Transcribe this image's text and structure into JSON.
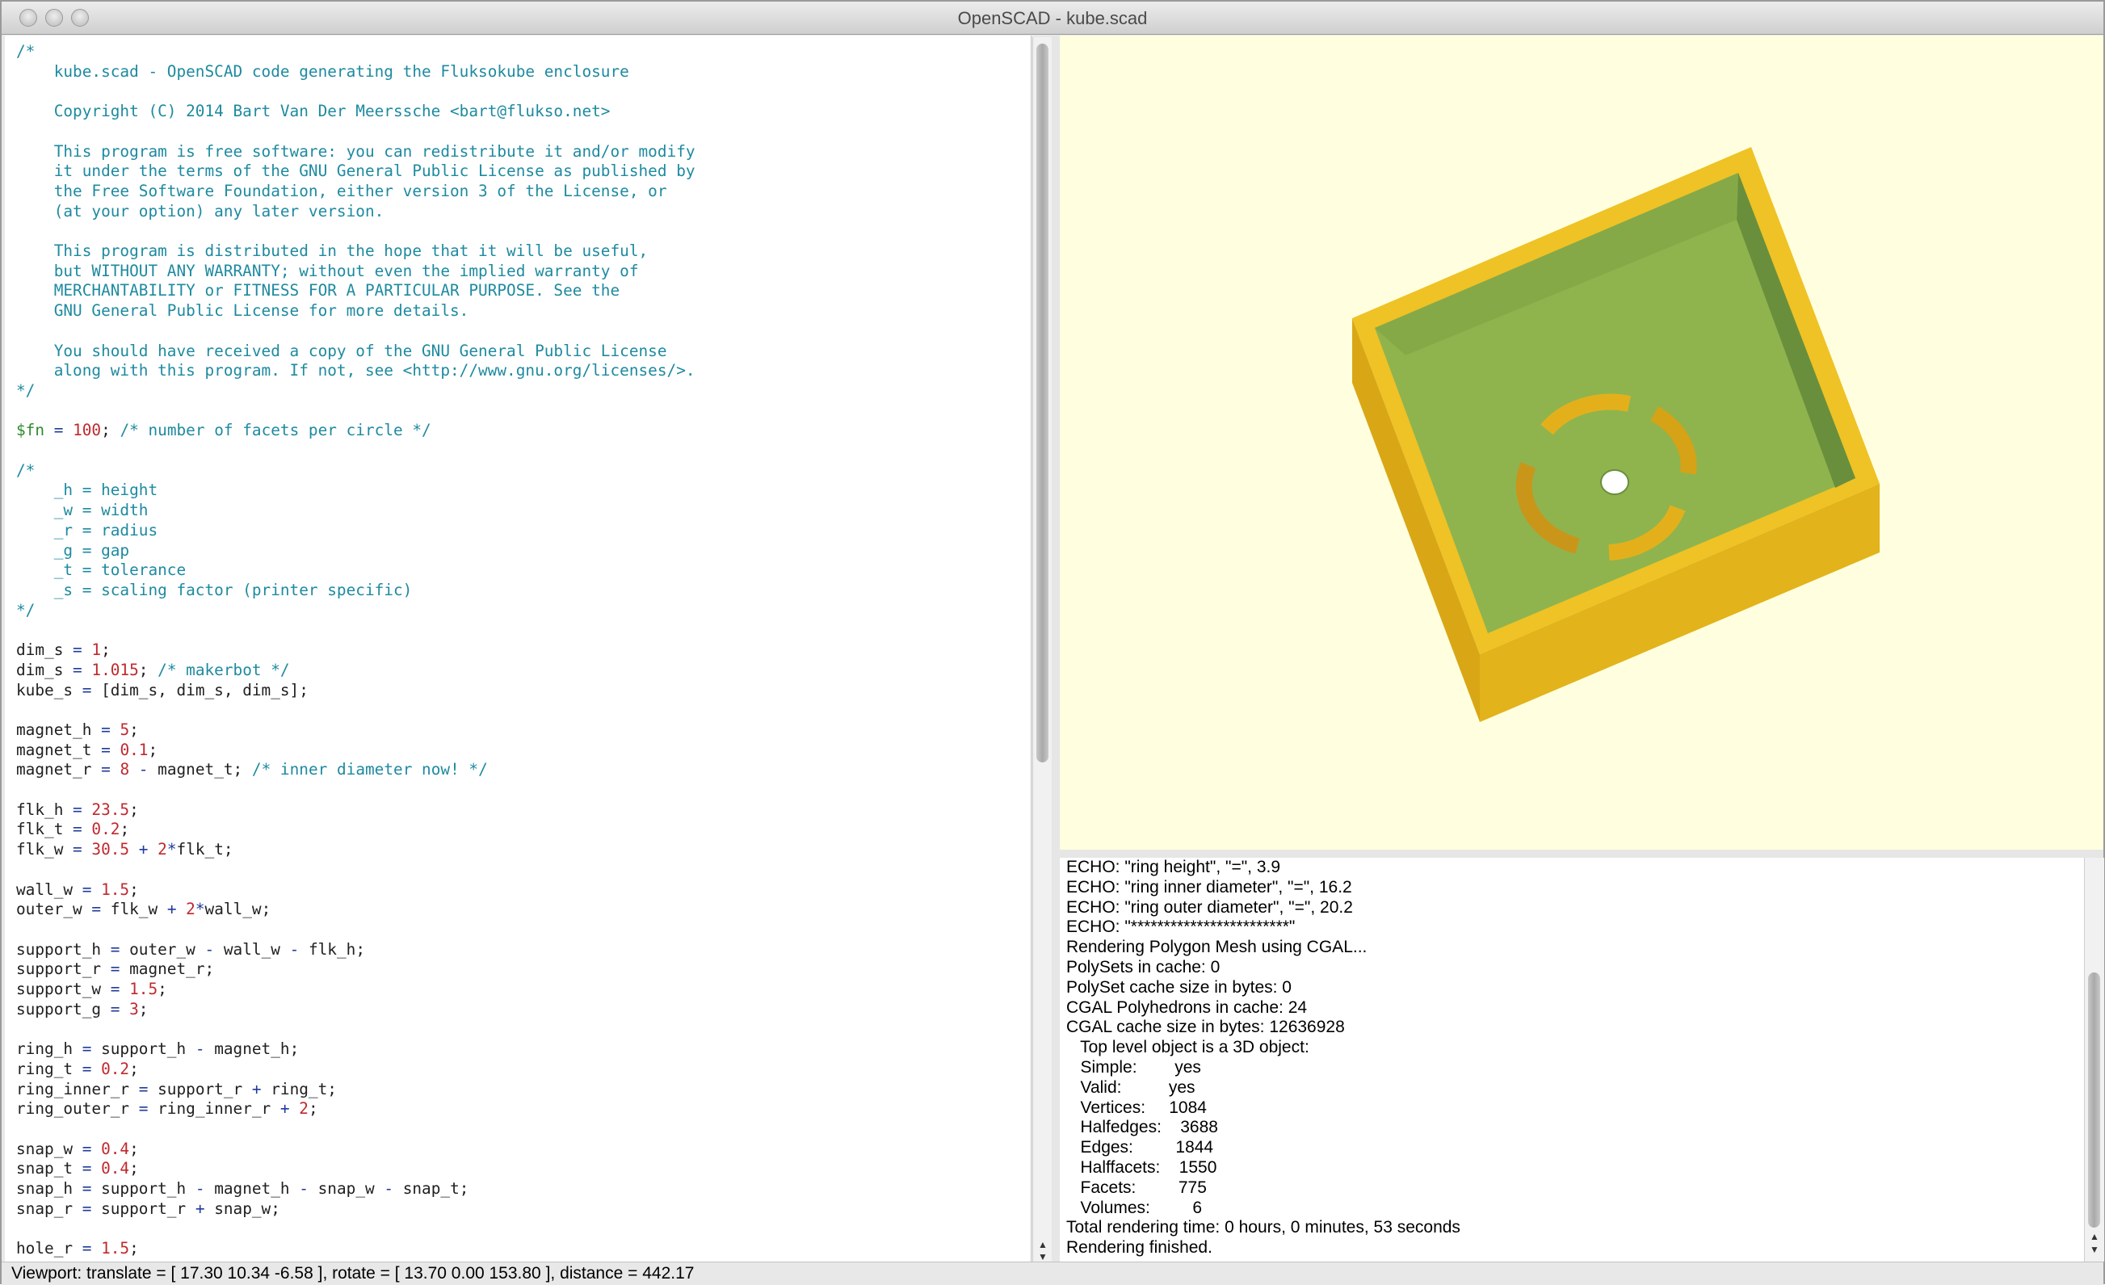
{
  "window": {
    "title": "OpenSCAD - kube.scad"
  },
  "editor": {
    "lines": [
      [
        {
          "c": "cm",
          "t": "/*"
        }
      ],
      [
        {
          "c": "cm",
          "t": "    kube.scad - OpenSCAD code generating the Fluksokube enclosure"
        }
      ],
      [],
      [
        {
          "c": "cm",
          "t": "    Copyright (C) 2014 Bart Van Der Meerssche <bart@flukso.net>"
        }
      ],
      [],
      [
        {
          "c": "cm",
          "t": "    This program is free software: you can redistribute it and/or modify"
        }
      ],
      [
        {
          "c": "cm",
          "t": "    it under the terms of the GNU General Public License as published by"
        }
      ],
      [
        {
          "c": "cm",
          "t": "    the Free Software Foundation, either version 3 of the License, or"
        }
      ],
      [
        {
          "c": "cm",
          "t": "    (at your option) any later version."
        }
      ],
      [],
      [
        {
          "c": "cm",
          "t": "    This program is distributed in the hope that it will be useful,"
        }
      ],
      [
        {
          "c": "cm",
          "t": "    but WITHOUT ANY WARRANTY; without even the implied warranty of"
        }
      ],
      [
        {
          "c": "cm",
          "t": "    MERCHANTABILITY or FITNESS FOR A PARTICULAR PURPOSE. See the"
        }
      ],
      [
        {
          "c": "cm",
          "t": "    GNU General Public License for more details."
        }
      ],
      [],
      [
        {
          "c": "cm",
          "t": "    You should have received a copy of the GNU General Public License"
        }
      ],
      [
        {
          "c": "cm",
          "t": "    along with this program. If not, see <http://www.gnu.org/licenses/>."
        }
      ],
      [
        {
          "c": "cm",
          "t": "*/"
        }
      ],
      [],
      [
        {
          "c": "sp",
          "t": "$fn"
        },
        {
          "c": "op",
          "t": " = "
        },
        {
          "c": "num",
          "t": "100"
        },
        {
          "c": "var",
          "t": "; "
        },
        {
          "c": "cm",
          "t": "/* number of facets per circle */"
        }
      ],
      [],
      [
        {
          "c": "cm",
          "t": "/*"
        }
      ],
      [
        {
          "c": "cm",
          "t": "    _h = height"
        }
      ],
      [
        {
          "c": "cm",
          "t": "    _w = width"
        }
      ],
      [
        {
          "c": "cm",
          "t": "    _r = radius"
        }
      ],
      [
        {
          "c": "cm",
          "t": "    _g = gap"
        }
      ],
      [
        {
          "c": "cm",
          "t": "    _t = tolerance"
        }
      ],
      [
        {
          "c": "cm",
          "t": "    _s = scaling factor (printer specific)"
        }
      ],
      [
        {
          "c": "cm",
          "t": "*/"
        }
      ],
      [],
      [
        {
          "c": "var",
          "t": "dim_s"
        },
        {
          "c": "op",
          "t": " = "
        },
        {
          "c": "num",
          "t": "1"
        },
        {
          "c": "var",
          "t": ";"
        }
      ],
      [
        {
          "c": "var",
          "t": "dim_s"
        },
        {
          "c": "op",
          "t": " = "
        },
        {
          "c": "num",
          "t": "1.015"
        },
        {
          "c": "var",
          "t": "; "
        },
        {
          "c": "cm",
          "t": "/* makerbot */"
        }
      ],
      [
        {
          "c": "var",
          "t": "kube_s"
        },
        {
          "c": "op",
          "t": " = "
        },
        {
          "c": "var",
          "t": "[dim_s, dim_s, dim_s];"
        }
      ],
      [],
      [
        {
          "c": "var",
          "t": "magnet_h"
        },
        {
          "c": "op",
          "t": " = "
        },
        {
          "c": "num",
          "t": "5"
        },
        {
          "c": "var",
          "t": ";"
        }
      ],
      [
        {
          "c": "var",
          "t": "magnet_t"
        },
        {
          "c": "op",
          "t": " = "
        },
        {
          "c": "num",
          "t": "0.1"
        },
        {
          "c": "var",
          "t": ";"
        }
      ],
      [
        {
          "c": "var",
          "t": "magnet_r"
        },
        {
          "c": "op",
          "t": " = "
        },
        {
          "c": "num",
          "t": "8"
        },
        {
          "c": "op",
          "t": " - "
        },
        {
          "c": "var",
          "t": "magnet_t; "
        },
        {
          "c": "cm",
          "t": "/* inner diameter now! */"
        }
      ],
      [],
      [
        {
          "c": "var",
          "t": "flk_h"
        },
        {
          "c": "op",
          "t": " = "
        },
        {
          "c": "num",
          "t": "23.5"
        },
        {
          "c": "var",
          "t": ";"
        }
      ],
      [
        {
          "c": "var",
          "t": "flk_t"
        },
        {
          "c": "op",
          "t": " = "
        },
        {
          "c": "num",
          "t": "0.2"
        },
        {
          "c": "var",
          "t": ";"
        }
      ],
      [
        {
          "c": "var",
          "t": "flk_w"
        },
        {
          "c": "op",
          "t": " = "
        },
        {
          "c": "num",
          "t": "30.5"
        },
        {
          "c": "op",
          "t": " + "
        },
        {
          "c": "num",
          "t": "2"
        },
        {
          "c": "op",
          "t": "*"
        },
        {
          "c": "var",
          "t": "flk_t;"
        }
      ],
      [],
      [
        {
          "c": "var",
          "t": "wall_w"
        },
        {
          "c": "op",
          "t": " = "
        },
        {
          "c": "num",
          "t": "1.5"
        },
        {
          "c": "var",
          "t": ";"
        }
      ],
      [
        {
          "c": "var",
          "t": "outer_w"
        },
        {
          "c": "op",
          "t": " = "
        },
        {
          "c": "var",
          "t": "flk_w"
        },
        {
          "c": "op",
          "t": " + "
        },
        {
          "c": "num",
          "t": "2"
        },
        {
          "c": "op",
          "t": "*"
        },
        {
          "c": "var",
          "t": "wall_w;"
        }
      ],
      [],
      [
        {
          "c": "var",
          "t": "support_h"
        },
        {
          "c": "op",
          "t": " = "
        },
        {
          "c": "var",
          "t": "outer_w"
        },
        {
          "c": "op",
          "t": " - "
        },
        {
          "c": "var",
          "t": "wall_w"
        },
        {
          "c": "op",
          "t": " - "
        },
        {
          "c": "var",
          "t": "flk_h;"
        }
      ],
      [
        {
          "c": "var",
          "t": "support_r"
        },
        {
          "c": "op",
          "t": " = "
        },
        {
          "c": "var",
          "t": "magnet_r;"
        }
      ],
      [
        {
          "c": "var",
          "t": "support_w"
        },
        {
          "c": "op",
          "t": " = "
        },
        {
          "c": "num",
          "t": "1.5"
        },
        {
          "c": "var",
          "t": ";"
        }
      ],
      [
        {
          "c": "var",
          "t": "support_g"
        },
        {
          "c": "op",
          "t": " = "
        },
        {
          "c": "num",
          "t": "3"
        },
        {
          "c": "var",
          "t": ";"
        }
      ],
      [],
      [
        {
          "c": "var",
          "t": "ring_h"
        },
        {
          "c": "op",
          "t": " = "
        },
        {
          "c": "var",
          "t": "support_h"
        },
        {
          "c": "op",
          "t": " - "
        },
        {
          "c": "var",
          "t": "magnet_h;"
        }
      ],
      [
        {
          "c": "var",
          "t": "ring_t"
        },
        {
          "c": "op",
          "t": " = "
        },
        {
          "c": "num",
          "t": "0.2"
        },
        {
          "c": "var",
          "t": ";"
        }
      ],
      [
        {
          "c": "var",
          "t": "ring_inner_r"
        },
        {
          "c": "op",
          "t": " = "
        },
        {
          "c": "var",
          "t": "support_r"
        },
        {
          "c": "op",
          "t": " + "
        },
        {
          "c": "var",
          "t": "ring_t;"
        }
      ],
      [
        {
          "c": "var",
          "t": "ring_outer_r"
        },
        {
          "c": "op",
          "t": " = "
        },
        {
          "c": "var",
          "t": "ring_inner_r"
        },
        {
          "c": "op",
          "t": " + "
        },
        {
          "c": "num",
          "t": "2"
        },
        {
          "c": "var",
          "t": ";"
        }
      ],
      [],
      [
        {
          "c": "var",
          "t": "snap_w"
        },
        {
          "c": "op",
          "t": " = "
        },
        {
          "c": "num",
          "t": "0.4"
        },
        {
          "c": "var",
          "t": ";"
        }
      ],
      [
        {
          "c": "var",
          "t": "snap_t"
        },
        {
          "c": "op",
          "t": " = "
        },
        {
          "c": "num",
          "t": "0.4"
        },
        {
          "c": "var",
          "t": ";"
        }
      ],
      [
        {
          "c": "var",
          "t": "snap_h"
        },
        {
          "c": "op",
          "t": " = "
        },
        {
          "c": "var",
          "t": "support_h"
        },
        {
          "c": "op",
          "t": " - "
        },
        {
          "c": "var",
          "t": "magnet_h"
        },
        {
          "c": "op",
          "t": " - "
        },
        {
          "c": "var",
          "t": "snap_w"
        },
        {
          "c": "op",
          "t": " - "
        },
        {
          "c": "var",
          "t": "snap_t;"
        }
      ],
      [
        {
          "c": "var",
          "t": "snap_r"
        },
        {
          "c": "op",
          "t": " = "
        },
        {
          "c": "var",
          "t": "support_r"
        },
        {
          "c": "op",
          "t": " + "
        },
        {
          "c": "var",
          "t": "snap_w;"
        }
      ],
      [],
      [
        {
          "c": "var",
          "t": "hole_r"
        },
        {
          "c": "op",
          "t": " = "
        },
        {
          "c": "num",
          "t": "1.5"
        },
        {
          "c": "var",
          "t": ";"
        }
      ]
    ]
  },
  "console": {
    "lines": [
      "ECHO: \"ring height\", \"=\", 3.9",
      "ECHO: \"ring inner diameter\", \"=\", 16.2",
      "ECHO: \"ring outer diameter\", \"=\", 20.2",
      "ECHO: \"************************\"",
      "Rendering Polygon Mesh using CGAL...",
      "PolySets in cache: 0",
      "PolySet cache size in bytes: 0",
      "CGAL Polyhedrons in cache: 24",
      "CGAL cache size in bytes: 12636928",
      "   Top level object is a 3D object:",
      "   Simple:        yes",
      "   Valid:          yes",
      "   Vertices:     1084",
      "   Halfedges:    3688",
      "   Edges:         1844",
      "   Halffacets:    1550",
      "   Facets:         775",
      "   Volumes:         6",
      "Total rendering time: 0 hours, 0 minutes, 53 seconds",
      "Rendering finished."
    ]
  },
  "status": {
    "viewport": "Viewport: translate = [ 17.30 10.34 -6.58 ], rotate = [ 13.70 0.00 153.80 ], distance = 442.17"
  },
  "colors": {
    "viewport_bg": "#ffffe0",
    "model_yellow": "#e8b820",
    "model_green": "#8fb44e"
  }
}
